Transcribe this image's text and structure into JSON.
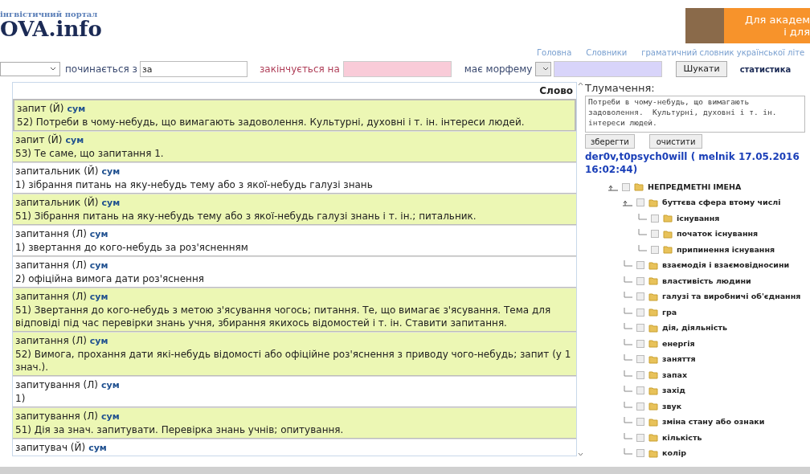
{
  "logo": {
    "tagline": "інгвістичний портал",
    "name": "OVA.info"
  },
  "banner": {
    "lines": [
      "Для академ",
      "і для"
    ]
  },
  "nav": [
    "Головна",
    "Словники",
    "граматичний словник української літе"
  ],
  "search": {
    "starts_label": "починається з",
    "starts_value": "за",
    "ends_label": "закінчується на",
    "morpheme_label": "має морфему",
    "button": "Шукати",
    "stats_link": "статистика"
  },
  "results": {
    "column": "Слово",
    "rows": [
      {
        "head": "запит (Й)",
        "source": "сум",
        "definition": "52) Потреби в чому-небудь, що вимагають задоволення. Культурні, духовні і т. ін. інтереси людей.",
        "highlighted": true,
        "selected": true
      },
      {
        "head": "запит (Й)",
        "source": "сум",
        "definition": "53) Те саме, що запитання 1.",
        "highlighted": true,
        "selected": false
      },
      {
        "head": "запитальник (Й)",
        "source": "сум",
        "definition": "1) зібрання питань на яку-небудь тему або з якої-небудь галузі знань",
        "highlighted": false,
        "selected": false
      },
      {
        "head": "запитальник (Й)",
        "source": "сум",
        "definition": "51) Зібрання питань на яку-небудь тему або з якої-небудь галузі знань і т. ін.; питальник.",
        "highlighted": true,
        "selected": false
      },
      {
        "head": "запитання (Л)",
        "source": "сум",
        "definition": "1) звертання до кого-небудь за роз'ясненням",
        "highlighted": false,
        "selected": false
      },
      {
        "head": "запитання (Л)",
        "source": "сум",
        "definition": "2) офіційна вимога дати роз'яснення",
        "highlighted": false,
        "selected": false
      },
      {
        "head": "запитання (Л)",
        "source": "сум",
        "definition": "51) Звертання до кого-небудь з метою з'ясування чогось; питання. Те, що вимагає з'ясування. Тема для відповіді під час перевірки знань учня, збирання якихось відомостей і т. ін. Ставити запитання.",
        "highlighted": true,
        "selected": false
      },
      {
        "head": "запитання (Л)",
        "source": "сум",
        "definition": "52) Вимога, прохання дати які-небудь відомості або офіційне роз'яснення з приводу чого-небудь; запит (у 1 знач.).",
        "highlighted": true,
        "selected": false
      },
      {
        "head": "запитування (Л)",
        "source": "сум",
        "definition": "1)",
        "highlighted": false,
        "selected": false
      },
      {
        "head": "запитування (Л)",
        "source": "сум",
        "definition": "51) Дія за знач. запитувати. Перевірка знань учнів; опитування.",
        "highlighted": true,
        "selected": false
      },
      {
        "head": "запитувач (Й)",
        "source": "сум",
        "highlighted": false,
        "selected": false
      }
    ]
  },
  "interpretation": {
    "label": "Тлумачення:",
    "value": "Потреби в чому-небудь, що вимагають задоволення.  Культурні, духовні і т. ін. інтереси людей.",
    "save": "зберегти",
    "clear": "очистити",
    "author": "der0v,t0psych0will ( melnik 17.05.2016 16:02:44)"
  },
  "tree": [
    {
      "label": "НЕПРЕДМЕТНІ ІМЕНА",
      "checked": false,
      "expanded": true,
      "children": [
        {
          "label": "буттєва сфера втому числі",
          "checked": false,
          "expanded": true,
          "children": [
            {
              "label": "існування",
              "checked": false
            },
            {
              "label": "початок існування",
              "checked": false
            },
            {
              "label": "припинення існування",
              "checked": false
            }
          ]
        },
        {
          "label": "взаємодія і взаємовідносини",
          "checked": false
        },
        {
          "label": "властивість людини",
          "checked": false
        },
        {
          "label": "галузі та виробничі об'єднання",
          "checked": false
        },
        {
          "label": "гра",
          "checked": false
        },
        {
          "label": "дія, діяльність",
          "checked": false
        },
        {
          "label": "енергія",
          "checked": false
        },
        {
          "label": "заняття",
          "checked": false
        },
        {
          "label": "запах",
          "checked": false
        },
        {
          "label": "захід",
          "checked": false
        },
        {
          "label": "звук",
          "checked": false
        },
        {
          "label": "зміна стану або ознаки",
          "checked": false
        },
        {
          "label": "кількість",
          "checked": false
        },
        {
          "label": "колір",
          "checked": false
        }
      ]
    }
  ]
}
